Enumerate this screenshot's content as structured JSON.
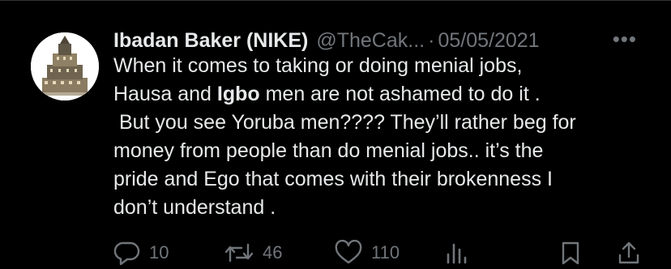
{
  "tweet": {
    "display_name": "Ibadan Baker (NIKE)",
    "handle": "@TheCak...",
    "separator": "·",
    "date": "05/05/2021",
    "more_icon": "more-dots-icon",
    "more_label": "•••",
    "body": {
      "line1": "When it comes to taking or doing menial jobs,",
      "line2_before": "Hausa and ",
      "line2_bold": "Igbo",
      "line2_after": " men are not ashamed to do it .",
      "line3": " But you see Yoruba men???? They’ll rather beg for",
      "line4": "money from people than do menial jobs.. it’s the",
      "line5": "pride and Ego that comes with their brokenness I",
      "line6": "don’t understand ."
    },
    "actions": {
      "reply": {
        "icon": "reply-icon",
        "count": "10"
      },
      "retweet": {
        "icon": "retweet-icon",
        "count": "46"
      },
      "like": {
        "icon": "heart-icon",
        "count": "110"
      },
      "views": {
        "icon": "views-icon"
      },
      "bookmark": {
        "icon": "bookmark-icon"
      },
      "share": {
        "icon": "share-icon"
      }
    }
  },
  "colors": {
    "background": "#000000",
    "text": "#e7e9ea",
    "muted": "#71767b",
    "divider": "#2f3336"
  }
}
